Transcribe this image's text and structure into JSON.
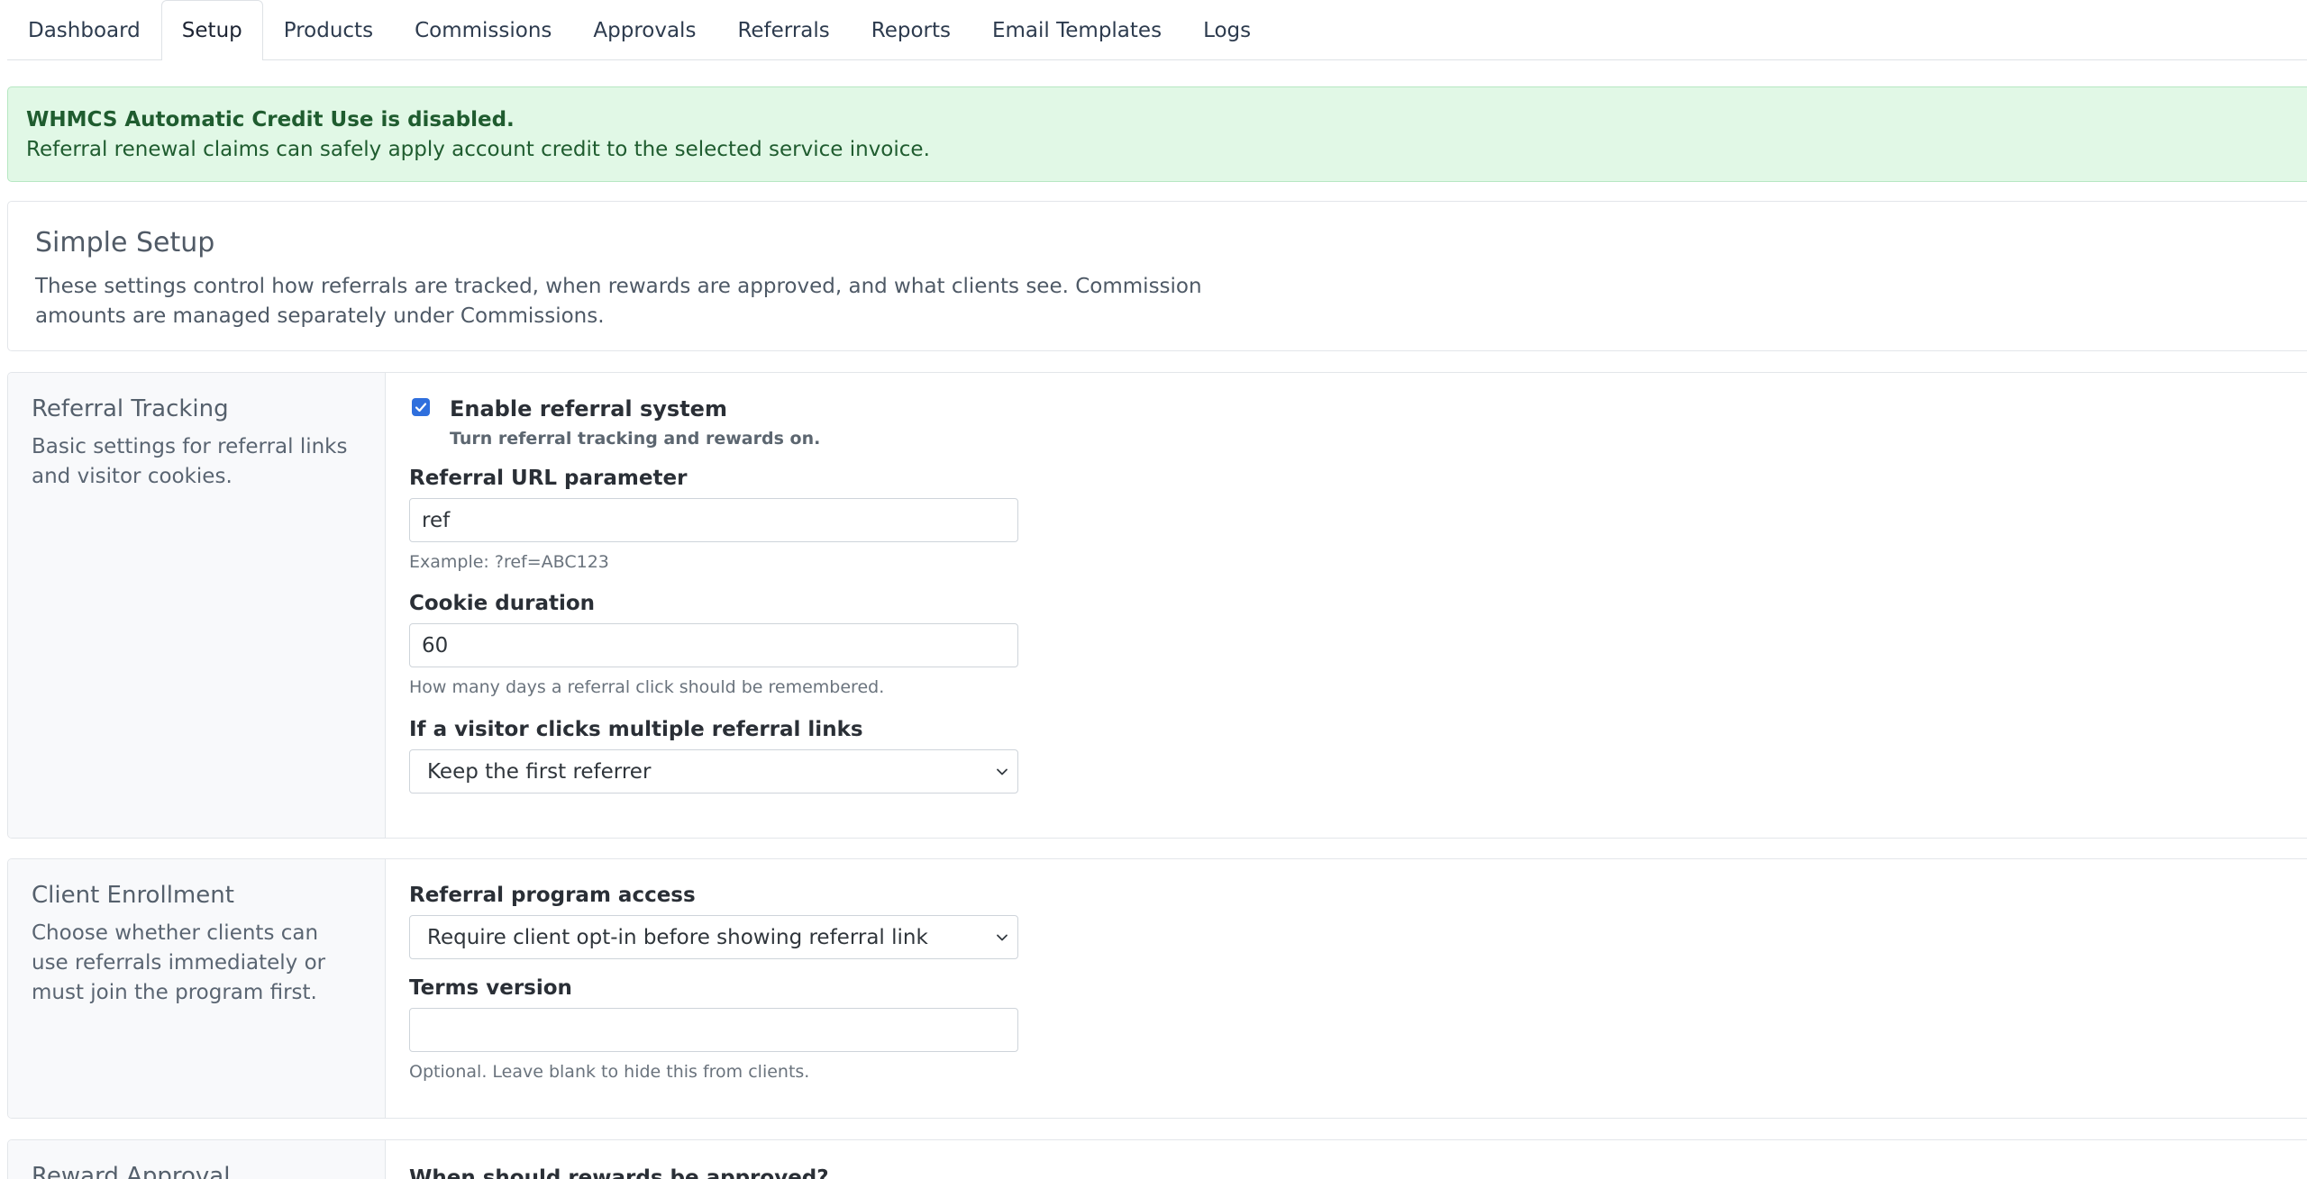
{
  "tabs": [
    "Dashboard",
    "Setup",
    "Products",
    "Commissions",
    "Approvals",
    "Referrals",
    "Reports",
    "Email Templates",
    "Logs"
  ],
  "alert": {
    "title": "WHMCS Automatic Credit Use is disabled.",
    "body": "Referral renewal claims can safely apply account credit to the selected service invoice."
  },
  "setup": {
    "title": "Simple Setup",
    "description": "These settings control how referrals are tracked, when rewards are approved, and what clients see. Commission amounts are managed separately under Commissions."
  },
  "tracking": {
    "title": "Referral Tracking",
    "description": "Basic settings for referral links and visitor cookies.",
    "enable_label": "Enable referral system",
    "enable_help": "Turn referral tracking and rewards on.",
    "enable_checked": true,
    "param_label": "Referral URL parameter",
    "param_value": "ref",
    "param_help": "Example: ?ref=ABC123",
    "cookie_label": "Cookie duration",
    "cookie_value": "60",
    "cookie_help": "How many days a referral click should be remembered.",
    "multi_label": "If a visitor clicks multiple referral links",
    "multi_value": "Keep the first referrer"
  },
  "enrollment": {
    "title": "Client Enrollment",
    "description": "Choose whether clients can use referrals immediately or must join the program first.",
    "access_label": "Referral program access",
    "access_value": "Require client opt-in before showing referral link",
    "terms_label": "Terms version",
    "terms_value": "",
    "terms_help": "Optional. Leave blank to hide this from clients."
  },
  "approval": {
    "title": "Reward Approval",
    "question_label": "When should rewards be approved?"
  },
  "colors": {
    "alert_bg": "#e1f8e6",
    "alert_text": "#1f5c2f",
    "checkbox": "#2f6fdd"
  }
}
